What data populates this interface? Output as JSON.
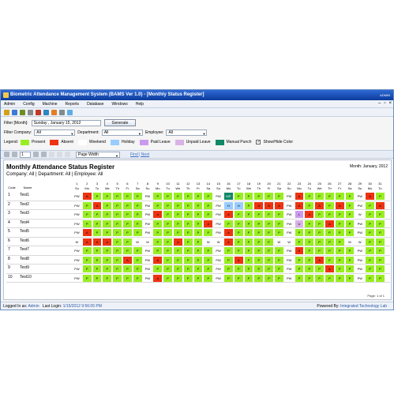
{
  "window": {
    "title": "Biometric Attendance Management System (BAMS Ver 1.0) - [Monthly Status Register]",
    "user": "ADMIN",
    "icon": "app-icon"
  },
  "menu": [
    "Admin",
    "Config",
    "Machine",
    "Reports",
    "Database",
    "Windows",
    "Help"
  ],
  "filter": {
    "label": "Filter [Month]:",
    "date": "Sunday , January 15, 2012",
    "generate_label": "Generate"
  },
  "filter2": {
    "company_label": "Filter Company:",
    "company_value": "All",
    "department_label": "Department:",
    "department_value": "All",
    "employee_label": "Employee:",
    "employee_value": "All"
  },
  "legend": {
    "label": "Legend:",
    "items": [
      {
        "label": "Present",
        "color": "#99ee22"
      },
      {
        "label": "Absent",
        "color": "#ee3311"
      },
      {
        "label": "Weekend",
        "color": "#ffffff"
      },
      {
        "label": "Holiday",
        "color": "#99ccff"
      },
      {
        "label": "Paid Leave",
        "color": "#cc99ee"
      },
      {
        "label": "Unpaid Leave",
        "color": "#d9b3e6"
      },
      {
        "label": "Manual Punch",
        "color": "#118866"
      }
    ],
    "show_hide_label": "Show/Hide Color"
  },
  "report_toolbar": {
    "page_value": "1",
    "zoom": "Page Width",
    "find_label": "Find | Next"
  },
  "report": {
    "title": "Monthly Attendance Status Register",
    "month": "Month: January, 2012",
    "filter_text": "Company:  All  |  Department:  All  |  Employee:  All",
    "code_header": "Code",
    "name_header": "Name",
    "days": [
      "1",
      "2",
      "3",
      "4",
      "5",
      "6",
      "7",
      "8",
      "9",
      "10",
      "11",
      "12",
      "13",
      "14",
      "15",
      "16",
      "17",
      "18",
      "19",
      "20",
      "21",
      "22",
      "23",
      "24",
      "25",
      "26",
      "27",
      "28",
      "29",
      "30",
      "31"
    ],
    "weekdays": [
      "Su",
      "Mo",
      "Tu",
      "We",
      "Th",
      "Fr",
      "Sa",
      "Su",
      "Mo",
      "Tu",
      "We",
      "Th",
      "Fr",
      "Sa",
      "Su",
      "Mo",
      "Tu",
      "We",
      "Th",
      "Fr",
      "Sa",
      "Su",
      "Mo",
      "Tu",
      "We",
      "Th",
      "Fr",
      "Sa",
      "Su",
      "Mo",
      "Tu"
    ],
    "rows": [
      {
        "code": "1",
        "name": "Test1",
        "cells": [
          "PW",
          "A",
          "P",
          "P",
          "P",
          "P",
          "P",
          "PW",
          "P",
          "P",
          "P",
          "P",
          "P",
          "P",
          "PW",
          "MP",
          "P",
          "P",
          "P",
          "P",
          "P",
          "PW",
          "A",
          "P",
          "P",
          "P",
          "P",
          "P",
          "PW",
          "A",
          "P"
        ]
      },
      {
        "code": "2",
        "name": "Test2",
        "cells": [
          "PW",
          "P",
          "A",
          "P",
          "P",
          "P",
          "P",
          "PW",
          "P",
          "P",
          "P",
          "P",
          "P",
          "P",
          "PW",
          "H",
          "H",
          "P",
          "A",
          "A",
          "A",
          "PW",
          "A",
          "P",
          "A",
          "P",
          "A",
          "P",
          "PW",
          "P",
          "A"
        ]
      },
      {
        "code": "3",
        "name": "Test3",
        "cells": [
          "PW",
          "P",
          "P",
          "P",
          "P",
          "P",
          "P",
          "PW",
          "A",
          "P",
          "P",
          "P",
          "P",
          "P",
          "PW",
          "A",
          "P",
          "P",
          "P",
          "P",
          "P",
          "PW",
          "L",
          "A",
          "P",
          "P",
          "P",
          "P",
          "W",
          "P",
          "P"
        ]
      },
      {
        "code": "4",
        "name": "Test4",
        "cells": [
          "PW",
          "P",
          "P",
          "P",
          "P",
          "P",
          "P",
          "PW",
          "P",
          "P",
          "P",
          "P",
          "P",
          "A",
          "PW",
          "P",
          "P",
          "P",
          "P",
          "P",
          "P",
          "PW",
          "U",
          "P",
          "P",
          "A",
          "P",
          "P",
          "PW",
          "P",
          "P"
        ]
      },
      {
        "code": "5",
        "name": "Test5",
        "cells": [
          "PW",
          "A",
          "P",
          "P",
          "P",
          "P",
          "P",
          "PW",
          "P",
          "P",
          "P",
          "P",
          "P",
          "P",
          "PW",
          "A",
          "P",
          "P",
          "P",
          "P",
          "P",
          "PW",
          "P",
          "P",
          "P",
          "P",
          "P",
          "P",
          "PW",
          "P",
          "P"
        ]
      },
      {
        "code": "6",
        "name": "Test6",
        "cells": [
          "W",
          "A",
          "A",
          "A",
          "P",
          "P",
          "W",
          "W",
          "P",
          "P",
          "A",
          "P",
          "P",
          "W",
          "W",
          "A",
          "P",
          "P",
          "P",
          "P",
          "W",
          "W",
          "P",
          "P",
          "P",
          "P",
          "P",
          "W",
          "W",
          "P",
          "P"
        ]
      },
      {
        "code": "7",
        "name": "Test7",
        "cells": [
          "PW",
          "P",
          "P",
          "P",
          "P",
          "P",
          "P",
          "PW",
          "P",
          "P",
          "P",
          "P",
          "P",
          "P",
          "PW",
          "P",
          "P",
          "P",
          "P",
          "P",
          "P",
          "PW",
          "A",
          "P",
          "P",
          "P",
          "P",
          "P",
          "PW",
          "P",
          "P"
        ]
      },
      {
        "code": "8",
        "name": "Test8",
        "cells": [
          "PW",
          "P",
          "P",
          "P",
          "P",
          "A",
          "P",
          "PW",
          "A",
          "P",
          "P",
          "P",
          "P",
          "P",
          "PW",
          "P",
          "A",
          "P",
          "P",
          "P",
          "P",
          "PW",
          "P",
          "P",
          "A",
          "P",
          "P",
          "P",
          "PW",
          "P",
          "P"
        ]
      },
      {
        "code": "9",
        "name": "Test9",
        "cells": [
          "PW",
          "P",
          "P",
          "P",
          "P",
          "P",
          "P",
          "PW",
          "P",
          "P",
          "P",
          "P",
          "P",
          "P",
          "PW",
          "P",
          "P",
          "P",
          "P",
          "P",
          "P",
          "PW",
          "P",
          "P",
          "P",
          "A",
          "P",
          "P",
          "PW",
          "P",
          "P"
        ]
      },
      {
        "code": "10",
        "name": "Test10",
        "cells": [
          "PW",
          "P",
          "P",
          "P",
          "P",
          "P",
          "P",
          "PW",
          "A",
          "P",
          "P",
          "P",
          "P",
          "P",
          "PW",
          "P",
          "P",
          "P",
          "P",
          "P",
          "P",
          "PW",
          "P",
          "P",
          "P",
          "P",
          "P",
          "P",
          "PW",
          "P",
          "P"
        ]
      }
    ],
    "pages": "Page: 1 of 1"
  },
  "status": {
    "login_label": "Logged In as:",
    "login_user": "Admin",
    "last_login_label": "Last Login:",
    "last_login_value": "1/15/2012 9:56:05 PM",
    "powered_label": "Powered By:",
    "powered_value": "Integrated Technology Lab"
  },
  "colors": {
    "P": "#99ee22",
    "A": "#ee3311",
    "W": "#ffffff",
    "PW": "#ffffff",
    "H": "#99ccff",
    "L": "#cc99ee",
    "U": "#d9b3e6",
    "MP": "#118866"
  }
}
